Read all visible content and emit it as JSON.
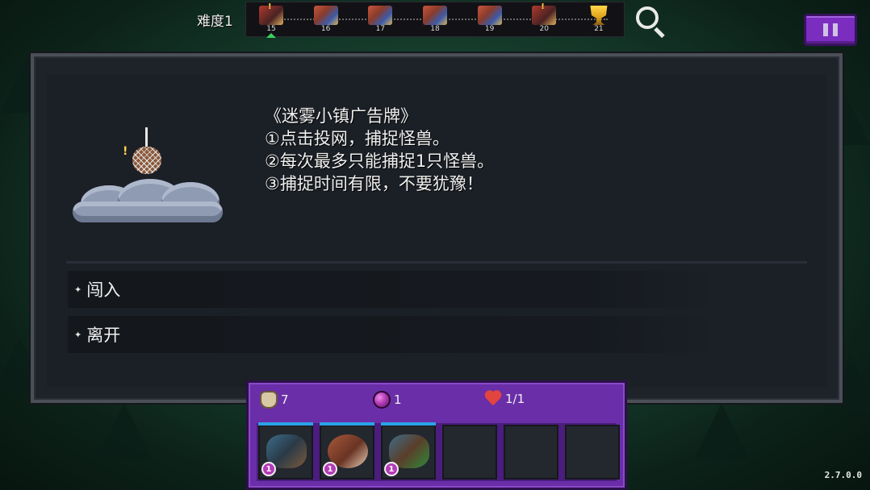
{
  "header": {
    "difficulty": "难度1",
    "stages": [
      {
        "num": "15",
        "type": "boss",
        "alert": "!",
        "current": true
      },
      {
        "num": "16",
        "type": "party"
      },
      {
        "num": "17",
        "type": "party"
      },
      {
        "num": "18",
        "type": "party"
      },
      {
        "num": "19",
        "type": "party"
      },
      {
        "num": "20",
        "type": "boss",
        "alert": "!"
      },
      {
        "num": "21",
        "type": "trophy"
      }
    ],
    "search_icon": "magnifier-icon",
    "pause_icon": "pause-icon"
  },
  "dialog": {
    "title": "《迷雾小镇广告牌》",
    "lines": [
      "①点击投网，捕捉怪兽。",
      "②每次最多只能捕捉1只怪兽。",
      "③捕捉时间有限，不要犹豫！"
    ],
    "illustration_alert": "!",
    "options": [
      {
        "bullet": "✦",
        "label": "闯入"
      },
      {
        "bullet": "✦",
        "label": "离开"
      }
    ]
  },
  "inventory": {
    "potions": "7",
    "orbs": "1",
    "hearts": "1/1",
    "slots": [
      {
        "filled": true,
        "level": "1",
        "monster": "m1"
      },
      {
        "filled": true,
        "level": "1",
        "monster": "m2"
      },
      {
        "filled": true,
        "level": "1",
        "monster": "m3"
      },
      {
        "filled": false
      },
      {
        "filled": false
      },
      {
        "filled": false
      }
    ]
  },
  "version": "2.7.0.0",
  "colors": {
    "accent_purple": "#7a2dbf",
    "dialog_bg": "#1e2229",
    "slot_top_bar": "#2aa3e8",
    "current_stage_marker": "#38d15a"
  }
}
